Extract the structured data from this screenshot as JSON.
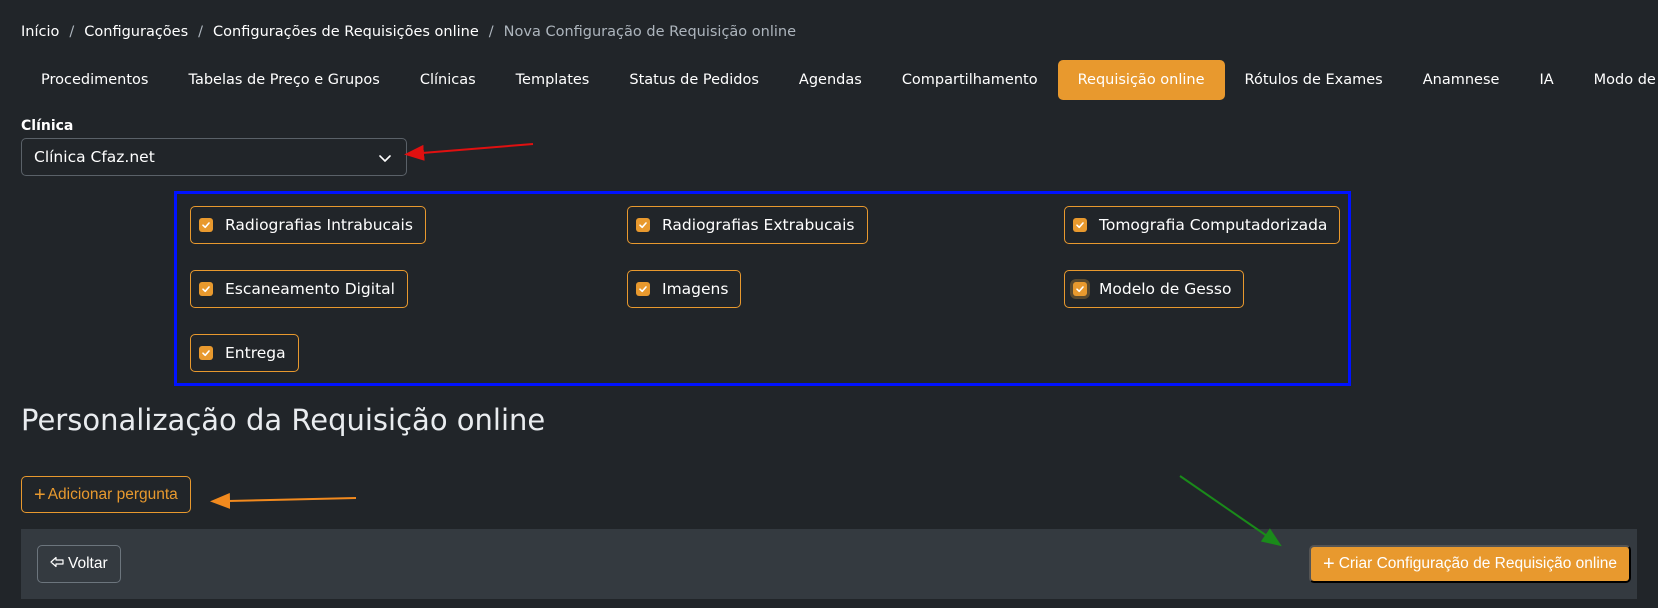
{
  "breadcrumb": [
    {
      "label": "Início"
    },
    {
      "label": "Configurações"
    },
    {
      "label": "Configurações de Requisições online"
    },
    {
      "label": "Nova Configuração de Requisição online"
    }
  ],
  "breadcrumb_separator": "/",
  "tabs": [
    {
      "label": "Procedimentos"
    },
    {
      "label": "Tabelas de Preço e Grupos"
    },
    {
      "label": "Clínicas"
    },
    {
      "label": "Templates"
    },
    {
      "label": "Status de Pedidos"
    },
    {
      "label": "Agendas"
    },
    {
      "label": "Compartilhamento"
    },
    {
      "label": "Requisição online",
      "active": true
    },
    {
      "label": "Rótulos de Exames"
    },
    {
      "label": "Anamnese"
    },
    {
      "label": "IA"
    },
    {
      "label": "Modo de entrega"
    }
  ],
  "clinic": {
    "label": "Clínica",
    "selected": "Clínica Cfaz.net"
  },
  "options": [
    {
      "label": "Radiografias Intrabucais",
      "checked": true
    },
    {
      "label": "Radiografias Extrabucais",
      "checked": true
    },
    {
      "label": "Tomografia Computadorizada",
      "checked": true
    },
    {
      "label": "Escaneamento Digital",
      "checked": true
    },
    {
      "label": "Imagens",
      "checked": true
    },
    {
      "label": "Modelo de Gesso",
      "checked": true
    },
    {
      "label": "Entrega",
      "checked": true
    }
  ],
  "section_title": "Personalização da Requisição online",
  "add_question_label": "Adicionar pergunta",
  "footer": {
    "back_label": "Voltar",
    "create_label": "Criar Configuração de Requisição online"
  },
  "colors": {
    "accent": "#e8992e",
    "background": "#212529",
    "footer": "#343a40",
    "annotation_box": "#0012ff",
    "annotation_red": "#e01010",
    "annotation_orange": "#f28a1e",
    "annotation_green": "#1a8a1a"
  },
  "icons": {
    "select": "chevron-down-icon",
    "checkbox": "check-icon",
    "add": "plus-icon",
    "back": "arrow-left-icon"
  }
}
